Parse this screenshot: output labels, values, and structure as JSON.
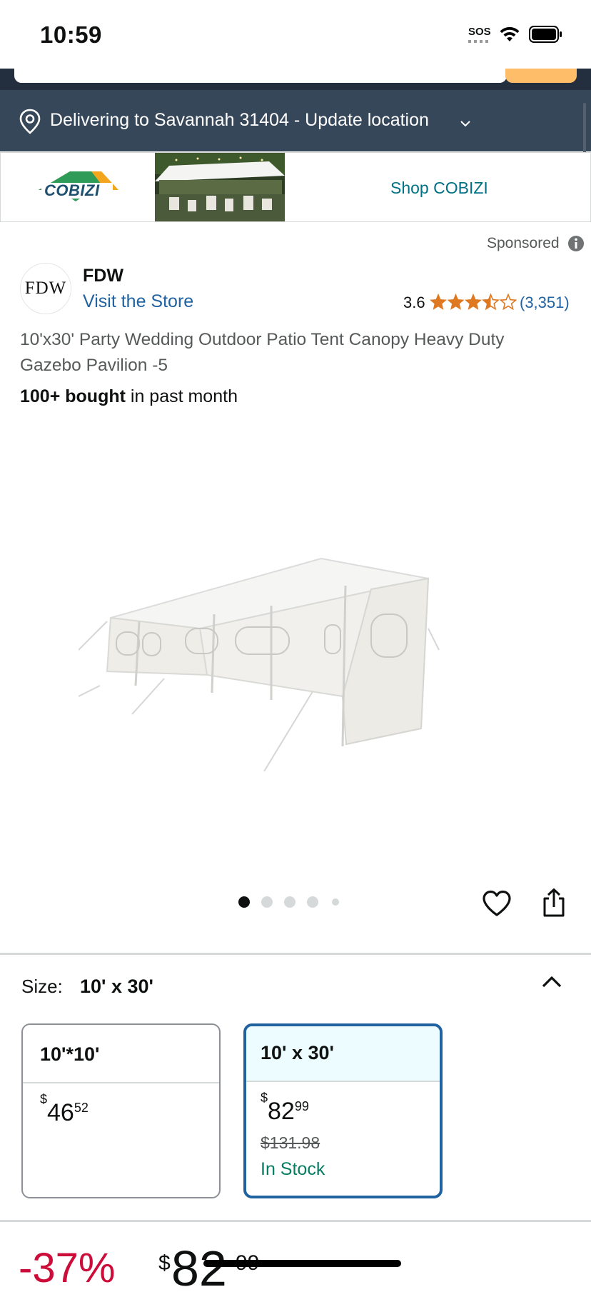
{
  "status_bar": {
    "time": "10:59",
    "sos": "SOS"
  },
  "location": {
    "text": "Delivering to Savannah 31404 - Update location"
  },
  "banner": {
    "brand_logo_text": "COBIZI",
    "cta": "Shop COBIZI"
  },
  "sponsored": {
    "label": "Sponsored"
  },
  "brand": {
    "avatar_text": "FDW",
    "name": "FDW",
    "visit_store": "Visit the Store"
  },
  "rating": {
    "value": "3.6",
    "stars_out_of_5": 3.6,
    "count": "(3,351)"
  },
  "product": {
    "title": "10'x30' Party Wedding Outdoor Patio Tent Canopy Heavy Duty Gazebo Pavilion -5",
    "bought_bold": "100+ bought",
    "bought_rest": " in past month"
  },
  "carousel": {
    "total_images": 5,
    "active_index": 0
  },
  "size": {
    "label": "Size:",
    "selected_value": "10' x 30'",
    "options": [
      {
        "name": "10'*10'",
        "price_symbol": "$",
        "price_whole": "46",
        "price_cents": "52",
        "selected": false
      },
      {
        "name": "10' x 30'",
        "price_symbol": "$",
        "price_whole": "82",
        "price_cents": "99",
        "list_price": "$131.98",
        "stock": "In Stock",
        "selected": true
      }
    ]
  },
  "price_bottom": {
    "discount": "-37%",
    "symbol": "$",
    "whole": "82",
    "cents": "99"
  },
  "colors": {
    "header_dark": "#232f3e",
    "location_bar": "#37475a",
    "link_blue": "#2162a1",
    "star_orange": "#de7921",
    "deal_red": "#cc0c39",
    "in_stock_green": "#067d62"
  }
}
